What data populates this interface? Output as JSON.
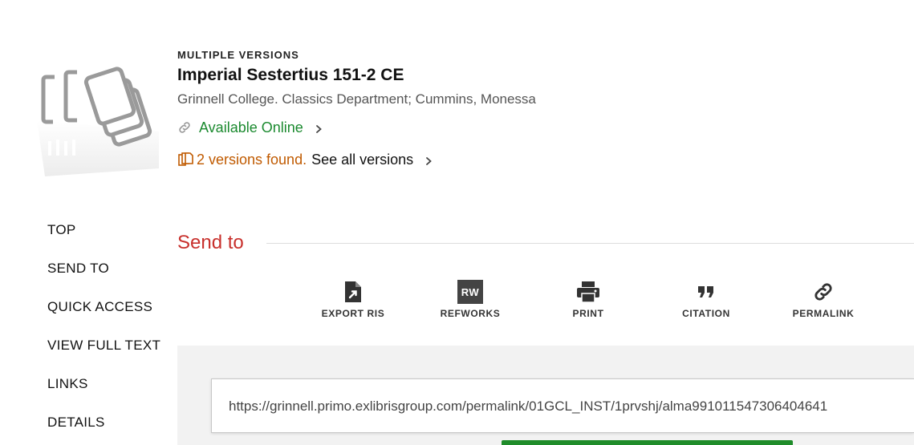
{
  "record": {
    "kind": "MULTIPLE VERSIONS",
    "title": "Imperial Sestertius 151-2 CE",
    "author": "Grinnell College. Classics Department; Cummins, Monessa",
    "availability": "Available Online",
    "versions_found": "2 versions found.",
    "see_all": "See all versions"
  },
  "nav": {
    "items": [
      "TOP",
      "SEND TO",
      "QUICK ACCESS",
      "VIEW FULL TEXT",
      "LINKS",
      "DETAILS"
    ]
  },
  "send_to": {
    "title": "Send to",
    "actions": [
      {
        "label": "EXPORT RIS",
        "icon": "export-file-icon"
      },
      {
        "label": "REFWORKS",
        "icon": "refworks-icon",
        "icon_text": "RW"
      },
      {
        "label": "PRINT",
        "icon": "printer-icon"
      },
      {
        "label": "CITATION",
        "icon": "quote-icon"
      },
      {
        "label": "PERMALINK",
        "icon": "link-icon"
      }
    ]
  },
  "permalink": {
    "url": "https://grinnell.primo.exlibrisgroup.com/permalink/01GCL_INST/1prvshj/alma991011547306404641"
  },
  "colors": {
    "available_green": "#1b8a2f",
    "versions_orange": "#c05a00",
    "section_red": "#c8302c",
    "copy_button_green": "#1f8c2a"
  }
}
